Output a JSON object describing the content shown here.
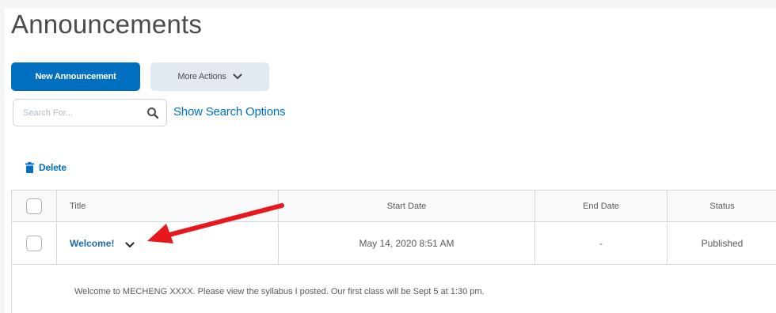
{
  "page": {
    "title": "Announcements"
  },
  "toolbar": {
    "new_label": "New Announcement",
    "more_label": "More Actions"
  },
  "search": {
    "placeholder": "Search For...",
    "show_options_label": "Show Search Options"
  },
  "actions": {
    "delete_label": "Delete"
  },
  "table": {
    "columns": [
      "Title",
      "Start Date",
      "End Date",
      "Status"
    ],
    "rows": [
      {
        "title": "Welcome!",
        "start_date": "May 14, 2020 8:51 AM",
        "end_date": "-",
        "status": "Published",
        "body": "Welcome to MECHENG XXXX. Please view the syllabus I posted. Our first class will be Sept 5 at 1:30 pm."
      }
    ]
  },
  "colors": {
    "primary": "#006fbf",
    "secondary_button": "#e3e9f1",
    "annotation_arrow": "#e8171b"
  },
  "icons": [
    "search-icon",
    "chevron-down-icon",
    "trash-icon",
    "red-arrow-annotation"
  ]
}
